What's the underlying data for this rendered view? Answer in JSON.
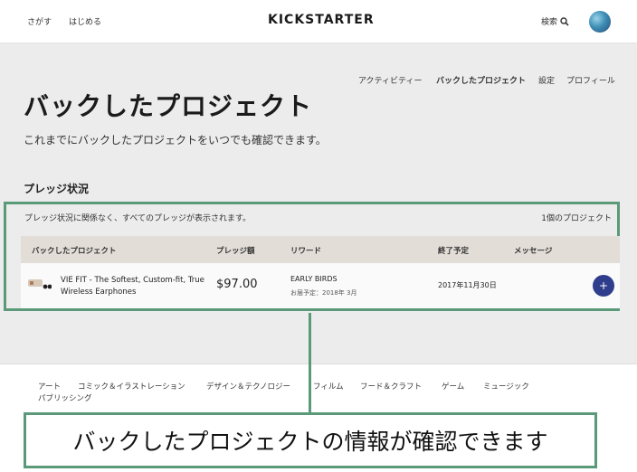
{
  "header": {
    "nav": [
      {
        "label": "さがす"
      },
      {
        "label": "はじめる"
      }
    ],
    "logo": "KICKSTARTER",
    "search_label": "検索",
    "search_icon": "search-icon"
  },
  "subnav": [
    {
      "label": "アクティビティー"
    },
    {
      "label": "バックしたプロジェクト"
    },
    {
      "label": "設定"
    },
    {
      "label": "プロフィール"
    }
  ],
  "page": {
    "title": "バックしたプロジェクト",
    "description": "これまでにバックしたプロジェクトをいつでも確認できます。"
  },
  "pledges": {
    "section_title": "プレッジ状況",
    "note": "プレッジ状況に関係なく、すべてのプレッジが表示されます。",
    "count": "1個のプロジェクト",
    "columns": [
      "バックしたプロジェクト",
      "プレッジ額",
      "リワード",
      "終了予定",
      "メッセージ"
    ],
    "rows": [
      {
        "project": "VIE FIT - The Softest, Custom-fit, True Wireless Earphones",
        "amount": "$97.00",
        "reward": "EARLY BIRDS",
        "delivery": "お届予定：2018年 3月",
        "end_date": "2017年11月30日",
        "action": "+"
      }
    ]
  },
  "footer": {
    "categories": [
      "アート",
      "コミック＆イラストレーション",
      "デザイン＆テクノロジー",
      "フィルム",
      "フード＆クラフト",
      "ゲーム",
      "ミュージック",
      "パブリッシング"
    ]
  },
  "callout": "バックしたプロジェクトの情報が確認できます",
  "colors": {
    "accent_green": "#5a9a78",
    "button_navy": "#2f3e8c",
    "background_gray": "#ececec"
  }
}
